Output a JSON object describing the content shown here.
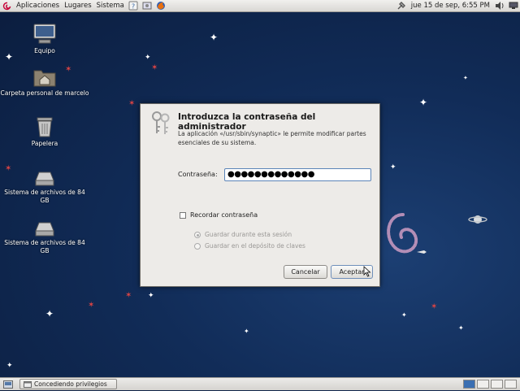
{
  "top_panel": {
    "menus": [
      "Aplicaciones",
      "Lugares",
      "Sistema"
    ],
    "clock": "jue 15 de sep,  6:55 PM"
  },
  "desktop": {
    "icons": [
      {
        "label": "Equipo",
        "icon": "computer-icon"
      },
      {
        "label": "Carpeta personal de marcelo",
        "icon": "home-folder-icon"
      },
      {
        "label": "Papelera",
        "icon": "trash-icon"
      },
      {
        "label": "Sistema de archivos de 84 GB",
        "icon": "drive-icon"
      },
      {
        "label": "Sistema de archivos de 84 GB",
        "icon": "drive-icon"
      }
    ]
  },
  "dialog": {
    "title": "Introduzca la contraseña del administrador",
    "description": "La aplicación «/usr/sbin/synaptic» le permite modificar partes esenciales de su sistema.",
    "password_label": "Contraseña:",
    "password_value": "●●●●●●●●●●●●●",
    "remember_label": "Recordar contraseña",
    "remember_checked": false,
    "option_session": "Guardar durante esta sesión",
    "option_keyring": "Guardar en el depósito de claves",
    "cancel_label": "Cancelar",
    "accept_label": "Aceptar"
  },
  "bottom_panel": {
    "task_label": "Concediendo privilegios",
    "workspaces": 4,
    "active_workspace": 1
  },
  "colors": {
    "desktop_bg": "#112c58",
    "panel": "#e4e2de",
    "dialog_bg": "#edebe8",
    "focus_border": "#5b84b8",
    "active_workspace": "#3b6fb2"
  }
}
